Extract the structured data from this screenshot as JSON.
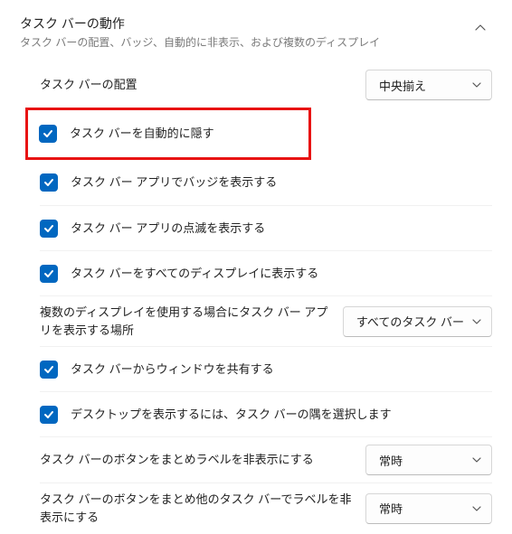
{
  "header": {
    "title": "タスク バーの動作",
    "subtitle": "タスク バーの配置、バッジ、自動的に非表示、および複数のディスプレイ"
  },
  "rows": {
    "alignment": {
      "label": "タスク バーの配置",
      "value": "中央揃え"
    },
    "autoHide": {
      "label": "タスク バーを自動的に隠す",
      "checked": true
    },
    "badges": {
      "label": "タスク バー アプリでバッジを表示する",
      "checked": true
    },
    "flashing": {
      "label": "タスク バー アプリの点滅を表示する",
      "checked": true
    },
    "allDisplays": {
      "label": "タスク バーをすべてのディスプレイに表示する",
      "checked": true
    },
    "multiDisplay": {
      "label": "複数のディスプレイを使用する場合にタスク バー アプリを表示する場所",
      "value": "すべてのタスク バー"
    },
    "shareWindow": {
      "label": "タスク バーからウィンドウを共有する",
      "checked": true
    },
    "showDesktop": {
      "label": "デスクトップを表示するには、タスク バーの隅を選択します",
      "checked": true
    },
    "combineMain": {
      "label": "タスク バーのボタンをまとめラベルを非表示にする",
      "value": "常時"
    },
    "combineOther": {
      "label": "タスク バーのボタンをまとめ他のタスク バーでラベルを非表示にする",
      "value": "常時"
    }
  },
  "colors": {
    "accent": "#0067c0",
    "highlight": "#e81313"
  }
}
